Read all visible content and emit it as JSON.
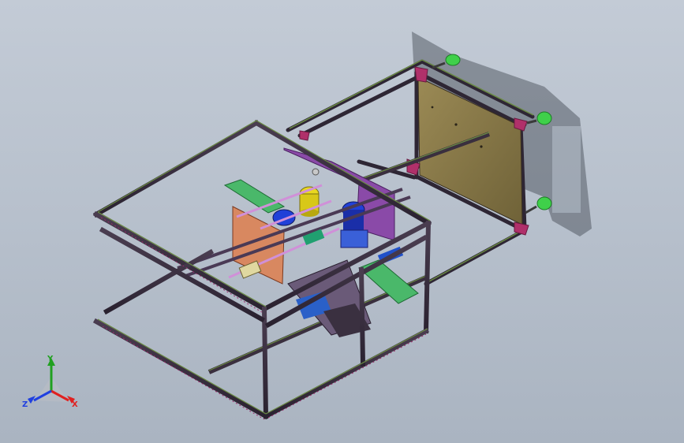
{
  "viewport": {
    "background_top": "#c3cbd6",
    "background_bottom": "#aab4c1"
  },
  "model": {
    "frame_color": "#3a2f3e",
    "frame_accent": "#5a7a3c",
    "panel_color": "#8c7a48",
    "bracket_color": "#b0306a",
    "foot_color": "#3fd04a"
  },
  "triad": {
    "x_label": "X",
    "y_label": "Y",
    "z_label": "Z",
    "x_color": "#e02020",
    "y_color": "#20a020",
    "z_color": "#2040e0"
  }
}
